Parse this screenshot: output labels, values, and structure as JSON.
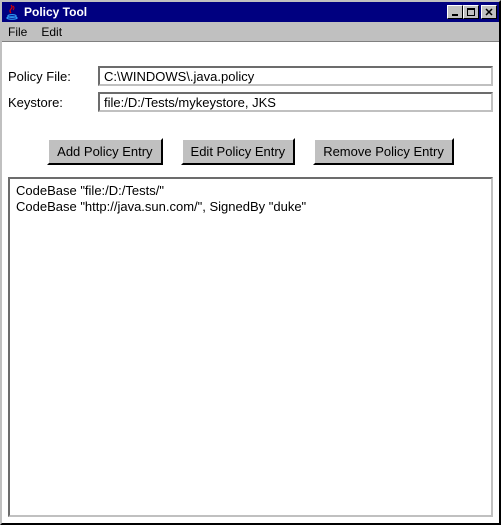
{
  "window": {
    "title": "Policy Tool"
  },
  "menubar": {
    "file": "File",
    "edit": "Edit"
  },
  "form": {
    "policy_label": "Policy File:",
    "policy_value": "C:\\WINDOWS\\.java.policy",
    "keystore_label": "Keystore:",
    "keystore_value": "file:/D:/Tests/mykeystore, JKS"
  },
  "buttons": {
    "add": "Add Policy Entry",
    "edit": "Edit Policy Entry",
    "remove": "Remove Policy Entry"
  },
  "entries": [
    "CodeBase \"file:/D:/Tests/\"",
    "CodeBase \"http://java.sun.com/\", SignedBy \"duke\""
  ]
}
